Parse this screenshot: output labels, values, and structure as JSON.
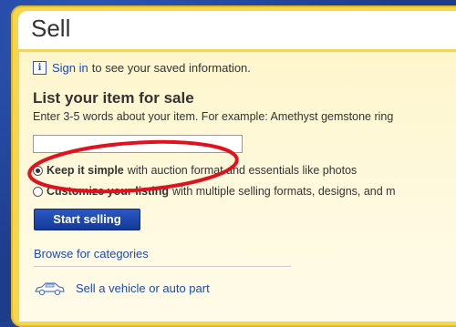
{
  "header": {
    "title": "Sell"
  },
  "info": {
    "signin_link": "Sign in",
    "text": "to see your saved information."
  },
  "form": {
    "heading": "List your item for sale",
    "hint": "Enter 3-5 words about your item. For example: Amethyst gemstone ring",
    "input_value": ""
  },
  "options": [
    {
      "bold": "Keep it simple",
      "rest": "with auction format and essentials like photos",
      "selected": true
    },
    {
      "bold": "Customize your listing",
      "rest": "with multiple selling formats, designs, and m",
      "selected": false
    }
  ],
  "buttons": {
    "start": "Start selling"
  },
  "links": {
    "browse": "Browse for categories",
    "vehicle": "Sell a vehicle or auto part"
  },
  "colors": {
    "accent": "#f6d64a",
    "link": "#1a49b8",
    "button": "#123a9a",
    "highlight_circle": "#e0121d"
  },
  "icons": {
    "info": "info-icon",
    "vehicle": "car-icon"
  }
}
